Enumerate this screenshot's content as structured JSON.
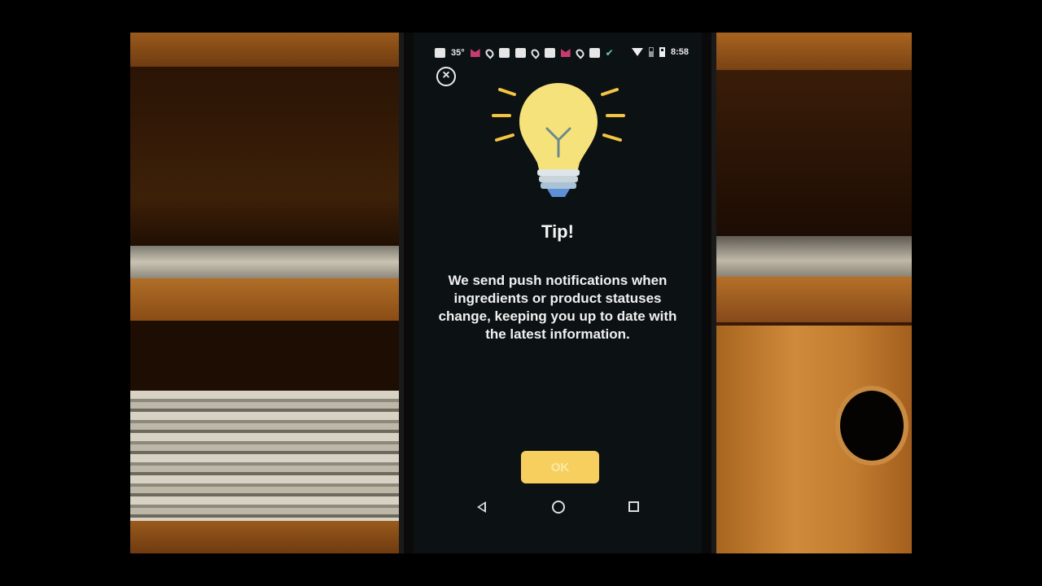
{
  "status_bar": {
    "temperature": "35°",
    "time": "8:58"
  },
  "dialog": {
    "title": "Tip!",
    "message": "We send push notifications when ingredients or product statuses change, keeping you up to date with the latest information.",
    "ok_label": "OK",
    "bulb_color": "#f6e27a",
    "accent_color": "#f6cf5f"
  },
  "navigation": {
    "back": "back-icon",
    "home": "home-icon",
    "recents": "recents-icon"
  }
}
